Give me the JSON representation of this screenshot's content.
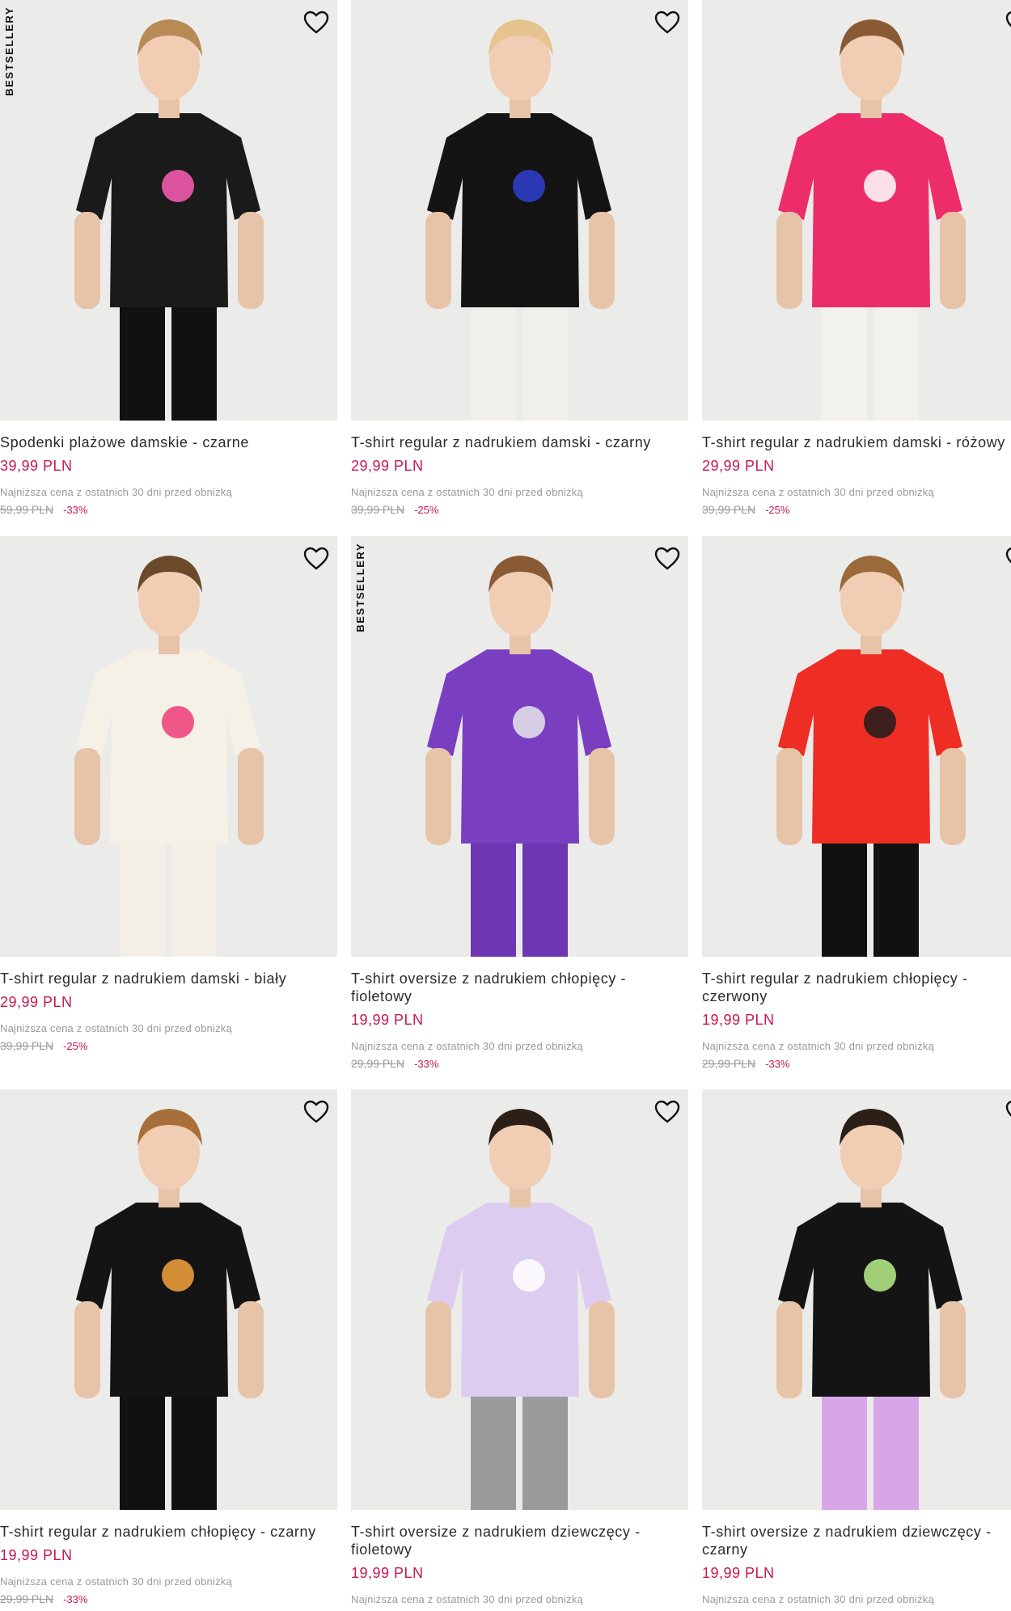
{
  "labels": {
    "bestseller": "BESTSELLERY",
    "lowest_price_note": "Najniższa cena z ostatnich 30 dni przed obniżką"
  },
  "products": [
    {
      "title": "Spodenki plażowe damskie - czarne",
      "price": "39,99 PLN",
      "old_price": "59,99 PLN",
      "discount": "-33%",
      "badge": true,
      "garment_color": "#1a1a1a",
      "accent_color": "#ff5fb6",
      "bottom_color": "#111111"
    },
    {
      "title": "T-shirt regular z nadrukiem damski - czarny",
      "price": "29,99 PLN",
      "old_price": "39,99 PLN",
      "discount": "-25%",
      "badge": false,
      "garment_color": "#141414",
      "accent_color": "#2f3ed0",
      "bottom_color": "#f1efe9"
    },
    {
      "title": "T-shirt regular z nadrukiem damski - różowy",
      "price": "29,99 PLN",
      "old_price": "39,99 PLN",
      "discount": "-25%",
      "badge": false,
      "garment_color": "#ec2d6a",
      "accent_color": "#ffffff",
      "bottom_color": "#f3f1ec"
    },
    {
      "title": "T-shirt regular z nadrukiem damski - biały",
      "price": "29,99 PLN",
      "old_price": "39,99 PLN",
      "discount": "-25%",
      "badge": false,
      "garment_color": "#f6f1e6",
      "accent_color": "#ee3c78",
      "bottom_color": "#f3efe6"
    },
    {
      "title": "T-shirt oversize z nadrukiem chłopięcy - fioletowy",
      "price": "19,99 PLN",
      "old_price": "29,99 PLN",
      "discount": "-33%",
      "badge": true,
      "garment_color": "#7a3fc0",
      "accent_color": "#e8e8ec",
      "bottom_color": "#6d36b2"
    },
    {
      "title": "T-shirt regular z nadrukiem chłopięcy - czerwony",
      "price": "19,99 PLN",
      "old_price": "29,99 PLN",
      "discount": "-33%",
      "badge": false,
      "garment_color": "#ee2d24",
      "accent_color": "#1d1d1d",
      "bottom_color": "#111111"
    },
    {
      "title": "T-shirt regular z nadrukiem chłopięcy - czarny",
      "price": "19,99 PLN",
      "old_price": "29,99 PLN",
      "discount": "-33%",
      "badge": false,
      "garment_color": "#141414",
      "accent_color": "#f5a23a",
      "bottom_color": "#111111"
    },
    {
      "title": "T-shirt oversize z nadrukiem dziewczęcy - fioletowy",
      "price": "19,99 PLN",
      "old_price": "",
      "discount": "",
      "badge": false,
      "garment_color": "#dccdf0",
      "accent_color": "#ffffff",
      "bottom_color": "#9a9a9a"
    },
    {
      "title": "T-shirt oversize z nadrukiem dziewczęcy - czarny",
      "price": "19,99 PLN",
      "old_price": "",
      "discount": "",
      "badge": false,
      "garment_color": "#141414",
      "accent_color": "#b9f08a",
      "bottom_color": "#d8a6e8"
    }
  ]
}
